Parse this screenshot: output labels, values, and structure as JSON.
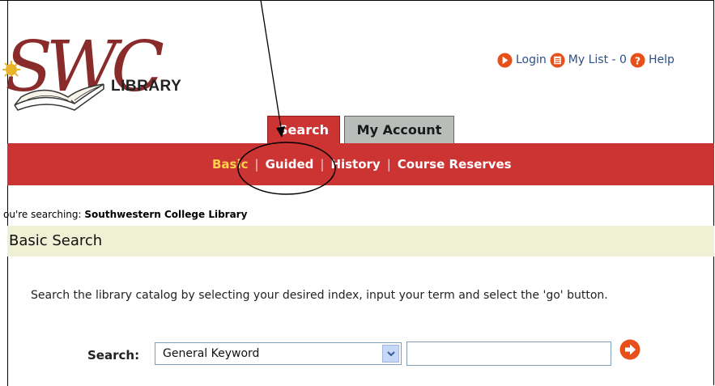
{
  "logo": {
    "text": "SWC",
    "subtitle": "LIBRARY"
  },
  "toplinks": {
    "login": "Login",
    "mylist": "My List - 0",
    "help": "Help",
    "icons": [
      "arrow-right-icon",
      "list-icon",
      "help-icon"
    ],
    "accent_color": "#e8501a"
  },
  "tabs": [
    {
      "label": "Search",
      "active": true
    },
    {
      "label": "My Account",
      "active": false
    }
  ],
  "nav": {
    "items": [
      "Basic",
      "Guided",
      "History",
      "Course Reserves"
    ],
    "active": "Basic",
    "bar_color": "#cc3333",
    "active_color": "#ffd24a"
  },
  "searching": {
    "prefix": "ou're searching:",
    "library": "Southwestern College Library"
  },
  "section": {
    "title": "Basic Search",
    "bg_color": "#f0f0d5"
  },
  "instructions": "Search the library catalog by selecting your desired index, input your term and select the 'go' button.",
  "search_form": {
    "label": "Search:",
    "index_selected": "General Keyword",
    "term_value": "",
    "go_icon": "go-arrow-icon"
  }
}
